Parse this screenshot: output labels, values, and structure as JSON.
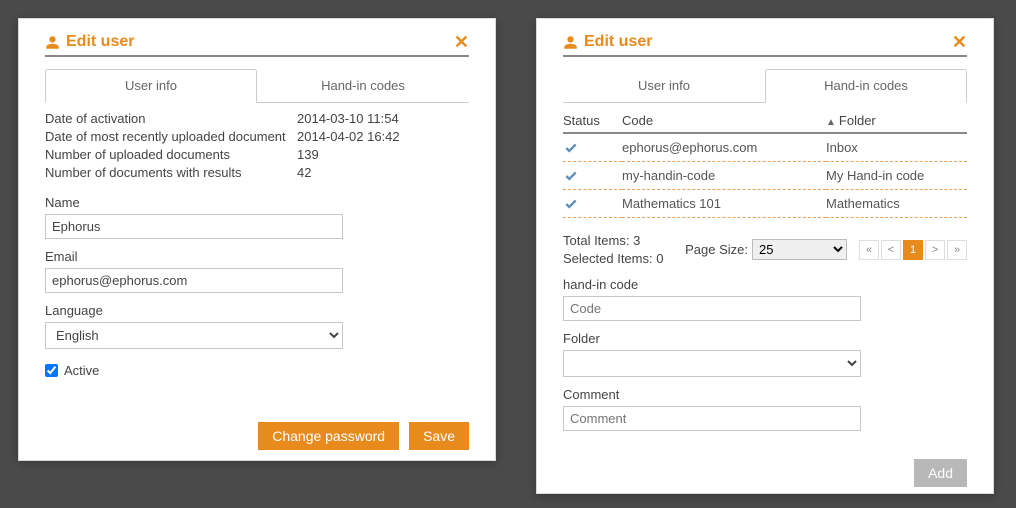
{
  "left": {
    "title": "Edit user",
    "tabs": {
      "userInfo": "User info",
      "handIn": "Hand-in codes"
    },
    "info": {
      "rows": [
        {
          "label": "Date of activation",
          "value": "2014-03-10 11:54"
        },
        {
          "label": "Date of most recently uploaded document",
          "value": "2014-04-02 16:42"
        },
        {
          "label": "Number of uploaded documents",
          "value": "139"
        },
        {
          "label": "Number of documents with results",
          "value": "42"
        }
      ]
    },
    "fields": {
      "nameLabel": "Name",
      "nameValue": "Ephorus",
      "emailLabel": "Email",
      "emailValue": "ephorus@ephorus.com",
      "languageLabel": "Language",
      "languageValue": "English",
      "activeLabel": "Active"
    },
    "buttons": {
      "changePassword": "Change password",
      "save": "Save"
    }
  },
  "right": {
    "title": "Edit user",
    "tabs": {
      "userInfo": "User info",
      "handIn": "Hand-in codes"
    },
    "columns": {
      "status": "Status",
      "code": "Code",
      "folder": "Folder"
    },
    "rows": [
      {
        "code": "ephorus@ephorus.com",
        "folder": "Inbox"
      },
      {
        "code": "my-handin-code",
        "folder": "My Hand-in code"
      },
      {
        "code": "Mathematics 101",
        "folder": "Mathematics"
      }
    ],
    "stats": {
      "totalLabel": "Total Items:",
      "totalValue": "3",
      "selectedLabel": "Selected Items:",
      "selectedValue": "0",
      "pageSizeLabel": "Page Size:",
      "pageSizeValue": "25",
      "currentPage": "1"
    },
    "form": {
      "handInLabel": "hand-in code",
      "handInPlaceholder": "Code",
      "folderLabel": "Folder",
      "commentLabel": "Comment",
      "commentPlaceholder": "Comment",
      "addLabel": "Add"
    }
  }
}
